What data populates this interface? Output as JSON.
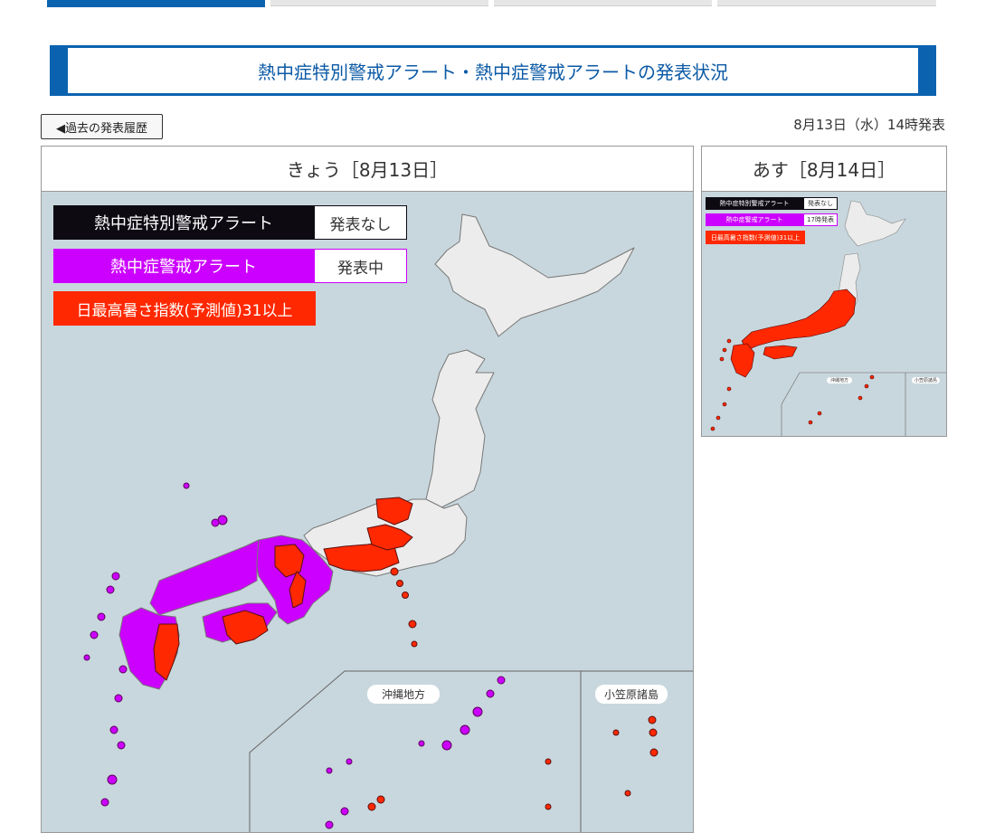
{
  "page_title": "熱中症特別警戒アラート・熱中症警戒アラートの発表状況",
  "history_button": "◀過去の発表履歴",
  "issued_time": "8月13日（水）14時発表",
  "colors": {
    "accent": "#0b63b0",
    "special_alert": "#0d0a12",
    "alert": "#cc00ff",
    "wbgt31": "#ff2800",
    "land_normal": "#ececec",
    "sea": "#c8d7dd"
  },
  "today": {
    "header": "きょう［8月13日］",
    "legend": {
      "special_alert_label": "熱中症特別警戒アラート",
      "special_alert_status": "発表なし",
      "alert_label": "熱中症警戒アラート",
      "alert_status": "発表中",
      "wbgt_label": "日最高暑さ指数(予測値)31以上"
    },
    "inset_labels": {
      "okinawa": "沖縄地方",
      "ogasawara": "小笠原諸島"
    }
  },
  "tomorrow": {
    "header": "あす［8月14日］",
    "legend": {
      "special_alert_label": "熱中症特別警戒アラート",
      "special_alert_status": "発表なし",
      "alert_label": "熱中症警戒アラート",
      "alert_status": "17時発表",
      "wbgt_label": "日最高暑さ指数(予測値)31以上"
    },
    "inset_labels": {
      "okinawa": "沖縄地方",
      "ogasawara": "小笠原諸島"
    }
  }
}
